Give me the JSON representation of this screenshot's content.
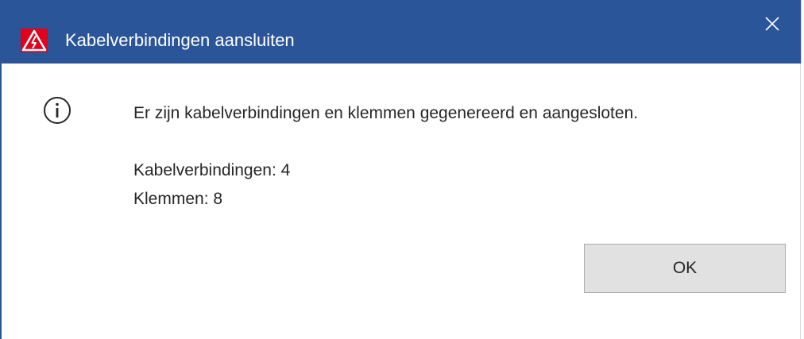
{
  "window": {
    "title": "Kabelverbindingen aansluiten",
    "app_icon": "warning-triangle-icon",
    "close_icon": "close-icon",
    "title_bar_color": "#2a5599"
  },
  "dialog": {
    "message_icon": "info-icon",
    "message": "Er zijn kabelverbindingen en klemmen gegenereerd en aangesloten.",
    "stats": {
      "cables": "Kabelverbindingen: 4",
      "clamps": "Klemmen: 8"
    },
    "ok_label": "OK"
  }
}
